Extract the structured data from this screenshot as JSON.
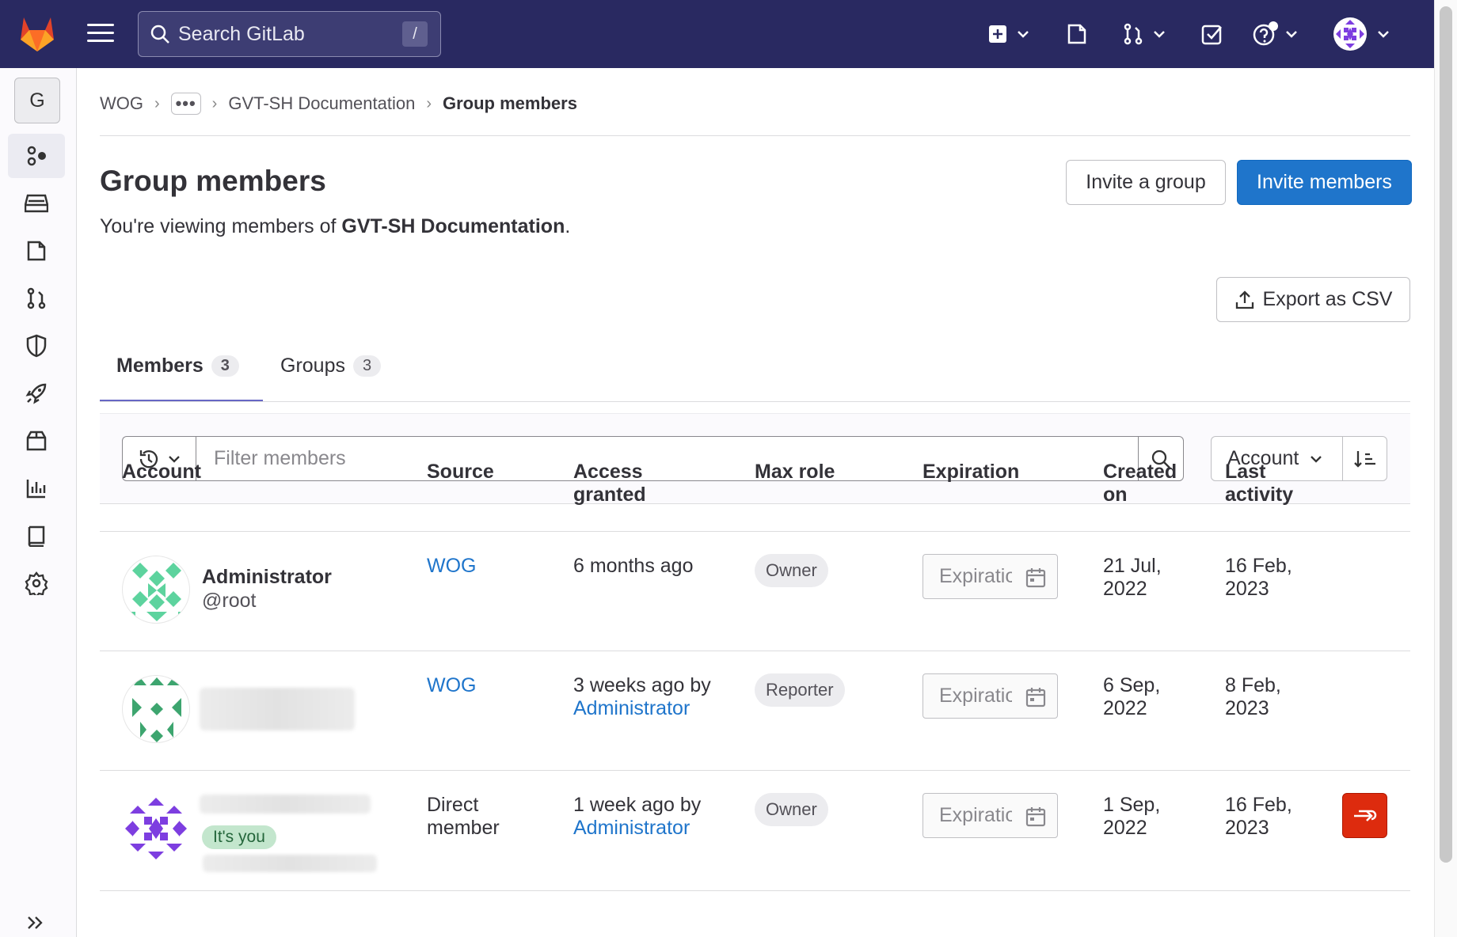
{
  "topbar": {
    "search_placeholder": "Search GitLab",
    "search_shortcut": "/"
  },
  "sidebar": {
    "group_letter": "G",
    "items": [
      "group-overview-icon",
      "issues-icon",
      "merge-requests-icon",
      "security-icon",
      "deploy-icon",
      "packages-icon",
      "analytics-icon",
      "wiki-icon",
      "settings-icon"
    ]
  },
  "breadcrumb": {
    "items": [
      "WOG",
      "•••",
      "GVT-SH Documentation"
    ],
    "current": "Group members"
  },
  "page": {
    "title": "Group members",
    "subtitle_prefix": "You're viewing members of ",
    "subtitle_group": "GVT-SH Documentation",
    "subtitle_suffix": ".",
    "invite_group_label": "Invite a group",
    "invite_members_label": "Invite members",
    "export_label": "Export as CSV"
  },
  "tabs": [
    {
      "label": "Members",
      "count": "3"
    },
    {
      "label": "Groups",
      "count": "3"
    }
  ],
  "filter": {
    "placeholder": "Filter members",
    "sort_label": "Account"
  },
  "table": {
    "headers": [
      "Account",
      "Source",
      "Access granted",
      "Max role",
      "Expiration",
      "Created on",
      "Last activity"
    ],
    "rows": [
      {
        "name": "Administrator",
        "username": "@root",
        "source": "WOG",
        "access": "6 months ago",
        "access_by": "",
        "role": "Owner",
        "expiration_placeholder": "Expiration",
        "created": "21 Jul, 2022",
        "last_activity": "16 Feb, 2023"
      },
      {
        "name": "",
        "username": "",
        "source": "WOG",
        "access": "3 weeks ago by",
        "access_by": "Administrator",
        "role": "Reporter",
        "expiration_placeholder": "Expiration",
        "created": "6 Sep, 2022",
        "last_activity": "8 Feb, 2023"
      },
      {
        "name": "",
        "username": "",
        "you_badge": "It's you",
        "source": "Direct member",
        "access": "1 week ago by",
        "access_by": "Administrator",
        "role": "Owner",
        "expiration_placeholder": "Expiration",
        "created": "1 Sep, 2022",
        "last_activity": "16 Feb, 2023"
      }
    ]
  },
  "colors": {
    "topbar": "#292961",
    "primary": "#1f75cb",
    "danger": "#dd2b0e",
    "tab_underline": "#6666c4"
  }
}
